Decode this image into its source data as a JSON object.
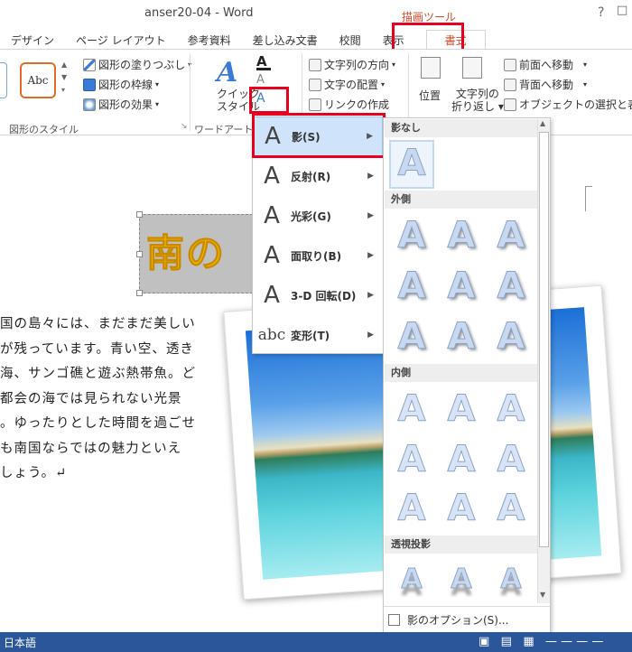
{
  "window": {
    "title": "anser20-04 - Word",
    "help": "?",
    "controls": "□"
  },
  "tool_label": "描画ツール",
  "tabs": [
    {
      "label": "デザイン"
    },
    {
      "label": "ページ レイアウト"
    },
    {
      "label": "参考資料"
    },
    {
      "label": "差し込み文書"
    },
    {
      "label": "校閲"
    },
    {
      "label": "表示"
    },
    {
      "label": "書式"
    }
  ],
  "ribbon": {
    "style_preview": "Abc",
    "shape_fill": "図形の塗りつぶし",
    "shape_outline": "図形の枠線",
    "shape_effects": "図形の効果",
    "group_shape_styles": "図形のスタイル",
    "quick_style_1": "クイック",
    "quick_style_2": "スタイル",
    "group_wordart": "ワードアートの",
    "text_direction": "文字列の方向",
    "text_align": "文字の配置",
    "create_link": "リンクの作成",
    "position": "位置",
    "wrap_1": "文字列の",
    "wrap_2": "折り返し",
    "bring_forward": "前面へ移動",
    "send_backward": "背面へ移動",
    "selection_pane": "オブジェクトの選択と表示"
  },
  "document": {
    "wordart": "南の",
    "body_lines": [
      "国の島々には、まだまだ美しい",
      "が残っています。青い空、透き",
      "海、サンゴ礁と遊ぶ熱帯魚。ど",
      "都会の海では見られない光景",
      "。ゆったりとした時間を過ごせ",
      "も南国ならではの魅力といえ",
      "しょう。↵"
    ]
  },
  "menu": {
    "items": [
      {
        "label": "影(S)",
        "glyph": "A"
      },
      {
        "label": "反射(R)",
        "glyph": "A"
      },
      {
        "label": "光彩(G)",
        "glyph": "A"
      },
      {
        "label": "面取り(B)",
        "glyph": "A"
      },
      {
        "label": "3-D 回転(D)",
        "glyph": "A"
      },
      {
        "label": "変形(T)",
        "glyph": "abc"
      }
    ]
  },
  "gallery": {
    "sections": [
      "影なし",
      "外側",
      "内側",
      "透視投影"
    ],
    "option_label": "影のオプション(S)...",
    "glyph": "A"
  },
  "status": {
    "language": "日本語"
  },
  "colors": {
    "accent": "#d24726",
    "highlight": "#e8001e",
    "statusbar": "#2b579a"
  }
}
